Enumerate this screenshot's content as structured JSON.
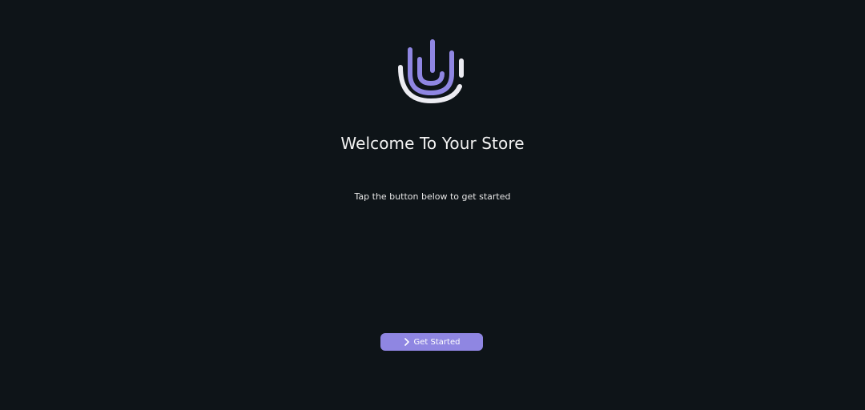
{
  "welcome": {
    "title": "Welcome To Your Store",
    "subtitle": "Tap the button below to get started",
    "button_label": "Get Started"
  },
  "icons": {
    "logo": "fingerprint-u-logo",
    "button_icon": "chevron-right-icon"
  },
  "colors": {
    "background": "#0e1418",
    "accent": "#8f86e2",
    "logo_light": "#ececf2",
    "text": "#f2f2f2"
  }
}
